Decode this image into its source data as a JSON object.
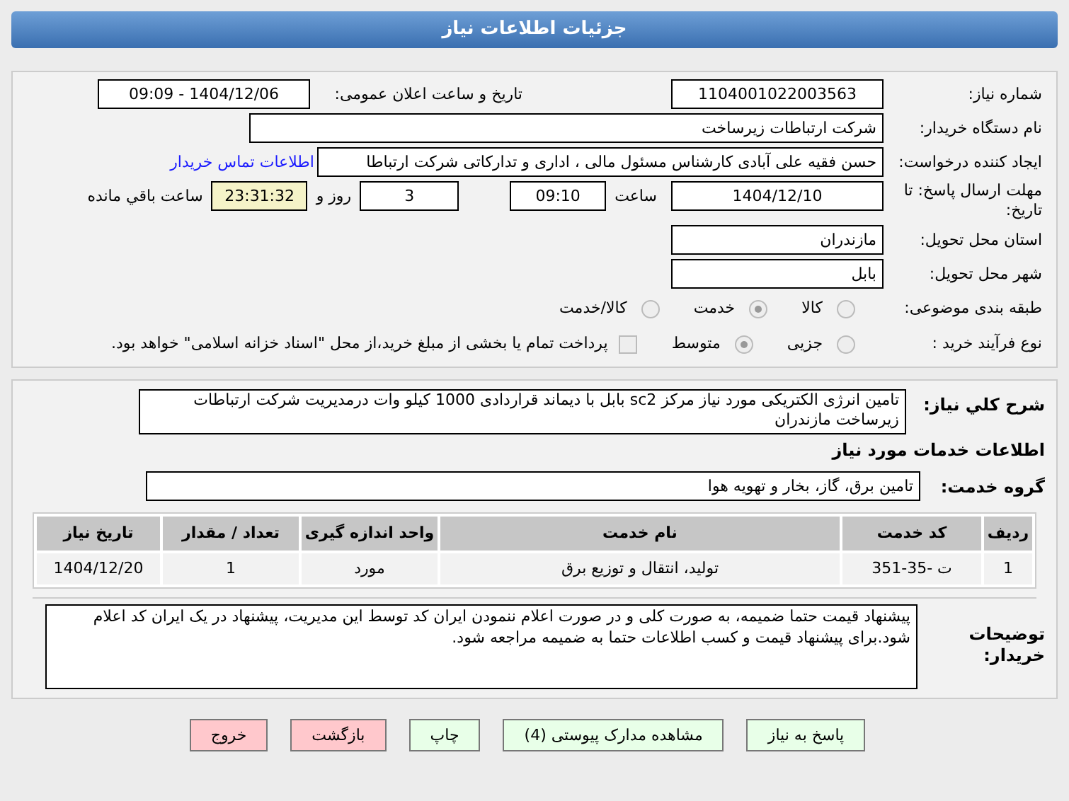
{
  "header": {
    "title": "جزئیات اطلاعات نیاز"
  },
  "need_number": {
    "label": "شماره نیاز:",
    "value": "1104001022003563"
  },
  "announce": {
    "label": "تاریخ و ساعت اعلان عمومی:",
    "value": "1404/12/06 - 09:09"
  },
  "buyer": {
    "label": "نام دستگاه خریدار:",
    "value": "شرکت ارتباطات زیرساخت"
  },
  "creator": {
    "label": "ایجاد کننده درخواست:",
    "value": "حسن فقیه علی آبادی کارشناس مسئول مالی ، اداری و تدارکاتی شرکت ارتباطا",
    "link": "اطلاعات تماس خریدار"
  },
  "deadline": {
    "label": "مهلت ارسال پاسخ: تا تاریخ:",
    "date": "1404/12/10",
    "time_label": "ساعت",
    "time": "09:10",
    "days": "3",
    "days_label": "روز و",
    "remaining": "23:31:32",
    "remaining_label": "ساعت باقي مانده"
  },
  "province": {
    "label": "استان محل تحویل:",
    "value": "مازندران"
  },
  "city": {
    "label": "شهر محل تحویل:",
    "value": "بابل"
  },
  "category": {
    "label": "طبقه بندی موضوعی:",
    "options": [
      {
        "label": "کالا",
        "selected": false
      },
      {
        "label": "خدمت",
        "selected": true
      },
      {
        "label": "کالا/خدمت",
        "selected": false
      }
    ]
  },
  "process": {
    "label": "نوع فرآیند خرید :",
    "options": [
      {
        "label": "جزیی",
        "selected": false
      },
      {
        "label": "متوسط",
        "selected": true
      }
    ],
    "payment": {
      "checked": false,
      "text": "پرداخت تمام یا بخشی از مبلغ خرید،از محل \"اسناد خزانه اسلامی\" خواهد بود."
    }
  },
  "description": {
    "label": "شرح کلي نياز:",
    "value": "تامین انرژی الکتریکی مورد نیاز مرکز sc2 بابل با دیماند قراردادی 1000 کیلو وات درمدیریت شرکت ارتباطات زیرساخت مازندران"
  },
  "services_heading": "اطلاعات خدمات مورد نیاز",
  "service_group": {
    "label": "گروه خدمت:",
    "value": "تامین برق، گاز، بخار و تهویه هوا"
  },
  "table": {
    "columns": [
      "ردیف",
      "کد خدمت",
      "نام خدمت",
      "واحد اندازه گیری",
      "تعداد / مقدار",
      "تاریخ نیاز"
    ],
    "rows": [
      [
        "1",
        "ت -35-351",
        "تولید، انتقال و توزیع برق",
        "مورد",
        "1",
        "1404/12/20"
      ]
    ]
  },
  "notes": {
    "label": "توضیحات خریدار:",
    "value": "پیشنهاد قیمت حتما ضمیمه، به صورت کلی و در صورت اعلام ننمودن ایران کد توسط این مدیریت، پیشنهاد در یک ایران کد اعلام شود.برای پیشنهاد قیمت و کسب اطلاعات حتما به ضمیمه مراجعه شود."
  },
  "buttons": [
    {
      "label": "پاسخ به نیاز",
      "kind": "action"
    },
    {
      "label": "مشاهده مدارک پیوستی (4)",
      "kind": "action"
    },
    {
      "label": "چاپ",
      "kind": "action"
    },
    {
      "label": "بازگشت",
      "kind": "exit"
    },
    {
      "label": "خروج",
      "kind": "exit"
    }
  ]
}
